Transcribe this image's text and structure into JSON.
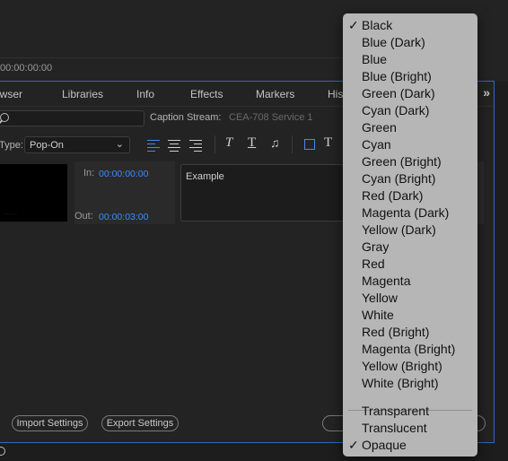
{
  "topbar": {
    "timecode": "00:00:00:00"
  },
  "tabs": [
    {
      "label": "owser"
    },
    {
      "label": "Libraries"
    },
    {
      "label": "Info"
    },
    {
      "label": "Effects"
    },
    {
      "label": "Markers"
    },
    {
      "label": "Hist"
    }
  ],
  "tab_more": "»",
  "caption_stream": {
    "label": "Caption Stream:",
    "value": "CEA-708 Service 1"
  },
  "type_select": {
    "label": "Type:",
    "value": "Pop-On",
    "chevron": "⌄"
  },
  "caption": {
    "in_label": "In:",
    "in_time": "00:00:00:00",
    "out_label": "Out:",
    "out_time": "00:00:03:00",
    "text": "Example",
    "thumb_text": "·······"
  },
  "buttons": {
    "import": "Import Settings",
    "export": "Export Settings"
  },
  "menu": {
    "check_glyph": "✓",
    "colors": [
      {
        "label": "Black",
        "checked": true
      },
      {
        "label": "Blue (Dark)",
        "checked": false
      },
      {
        "label": "Blue",
        "checked": false
      },
      {
        "label": "Blue (Bright)",
        "checked": false
      },
      {
        "label": "Green (Dark)",
        "checked": false
      },
      {
        "label": "Cyan (Dark)",
        "checked": false
      },
      {
        "label": "Green",
        "checked": false
      },
      {
        "label": "Cyan",
        "checked": false
      },
      {
        "label": "Green (Bright)",
        "checked": false
      },
      {
        "label": "Cyan (Bright)",
        "checked": false
      },
      {
        "label": "Red (Dark)",
        "checked": false
      },
      {
        "label": "Magenta (Dark)",
        "checked": false
      },
      {
        "label": "Yellow (Dark)",
        "checked": false
      },
      {
        "label": "Gray",
        "checked": false
      },
      {
        "label": "Red",
        "checked": false
      },
      {
        "label": "Magenta",
        "checked": false
      },
      {
        "label": "Yellow",
        "checked": false
      },
      {
        "label": "White",
        "checked": false
      },
      {
        "label": "Red (Bright)",
        "checked": false
      },
      {
        "label": "Magenta (Bright)",
        "checked": false
      },
      {
        "label": "Yellow (Bright)",
        "checked": false
      },
      {
        "label": "White (Bright)",
        "checked": false
      }
    ],
    "opacity": [
      {
        "label": "Transparent",
        "checked": false
      },
      {
        "label": "Translucent",
        "checked": false
      },
      {
        "label": "Opaque",
        "checked": true
      }
    ]
  },
  "theme": {
    "accent": "#3d8bff",
    "panel_border": "#3a63c7",
    "menu_bg": "#b6b6b6"
  }
}
